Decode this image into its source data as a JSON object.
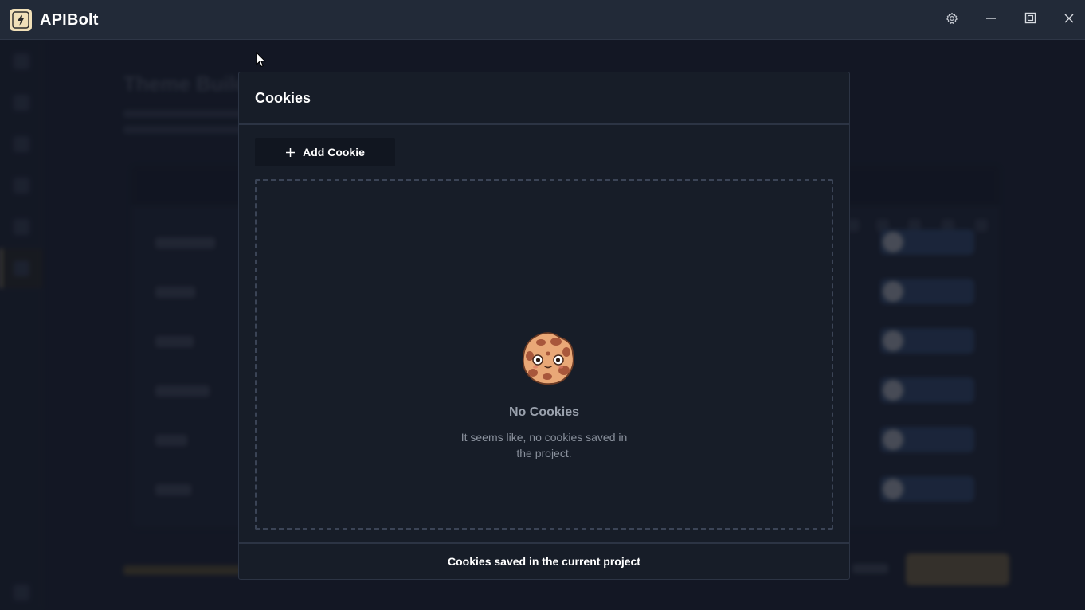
{
  "app": {
    "title": "APIBolt",
    "logo_icon": "lightning-bolt-icon",
    "logo_color": "#f1e0b8"
  },
  "titlebar": {
    "buttons": [
      {
        "name": "settings",
        "icon": "gear-icon"
      },
      {
        "name": "minimize",
        "icon": "minimize-icon"
      },
      {
        "name": "maximize",
        "icon": "maximize-icon"
      },
      {
        "name": "close",
        "icon": "close-icon"
      }
    ]
  },
  "background": {
    "heading": "Theme Builder"
  },
  "modal": {
    "title": "Cookies",
    "add_button_label": "Add Cookie",
    "add_button_icon": "plus-icon",
    "empty_state": {
      "icon": "cookie-icon",
      "title": "No Cookies",
      "description": "It seems like, no cookies saved in the project."
    },
    "footer_text": "Cookies saved in the current project"
  },
  "colors": {
    "background": "#1a2030",
    "titlebar": "#222a38",
    "modal_bg": "#171d28",
    "border": "#2c3444",
    "accent": "#c9b27a"
  }
}
